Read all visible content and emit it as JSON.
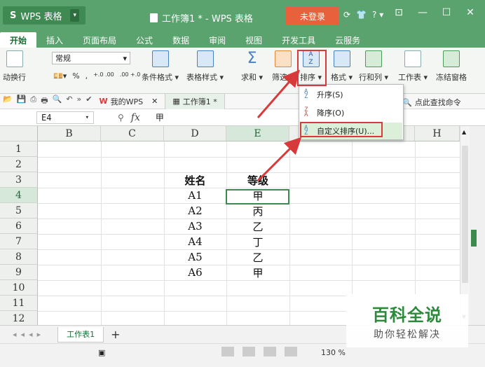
{
  "titlebar": {
    "app_name": "WPS 表格",
    "doc_title": "工作簿1 * - WPS 表格",
    "login": "未登录",
    "icons": [
      "shirt-icon",
      "help-icon"
    ],
    "help_label": "?"
  },
  "tabs": [
    "开始",
    "插入",
    "页面布局",
    "公式",
    "数据",
    "审阅",
    "视图",
    "开发工具",
    "云服务"
  ],
  "ribbon": {
    "wrap_label": "动换行",
    "number_format": "常规",
    "percent": "%",
    "decimal_inc": "+.0 .00",
    "decimal_dec": ".00 +.0",
    "cond_format": "条件格式 ▾",
    "table_style": "表格样式 ▾",
    "sum": "求和 ▾",
    "filter": "筛选 ▾",
    "sort": "排序 ▾",
    "format": "格式 ▾",
    "rowcol": "行和列 ▾",
    "worksheet": "工作表 ▾",
    "freeze": "冻结窗格"
  },
  "quickbar": {
    "mywps": "我的WPS",
    "doc_tab": "工作簿1 *",
    "search": "点此查找命令"
  },
  "formula": {
    "cell_ref": "E4",
    "fx": "fx",
    "value": "甲"
  },
  "grid": {
    "columns": [
      "B",
      "C",
      "D",
      "E",
      "F",
      "G",
      "H"
    ],
    "rows": [
      "1",
      "2",
      "3",
      "4",
      "5",
      "6",
      "7",
      "8",
      "9",
      "10",
      "11",
      "12"
    ],
    "header_name": "姓名",
    "header_grade": "等级",
    "records": [
      {
        "name": "A1",
        "grade": "甲"
      },
      {
        "name": "A2",
        "grade": "丙"
      },
      {
        "name": "A3",
        "grade": "乙"
      },
      {
        "name": "A4",
        "grade": "丁"
      },
      {
        "name": "A5",
        "grade": "乙"
      },
      {
        "name": "A6",
        "grade": "甲"
      }
    ]
  },
  "dropdown": {
    "ascending": "升序(S)",
    "descending": "降序(O)",
    "custom": "自定义排序(U)..."
  },
  "sheetbar": {
    "sheet_tab": "工作表1",
    "add": "+"
  },
  "status": {
    "zoom": "130 %"
  },
  "watermark": {
    "title": "百科全说",
    "subtitle": "助你轻松解决"
  },
  "colors": {
    "ribbon_green": "#5aa36e",
    "highlight_red": "#d63a3a",
    "selection_green": "#3e8a4e",
    "login_orange": "#e8603c"
  }
}
